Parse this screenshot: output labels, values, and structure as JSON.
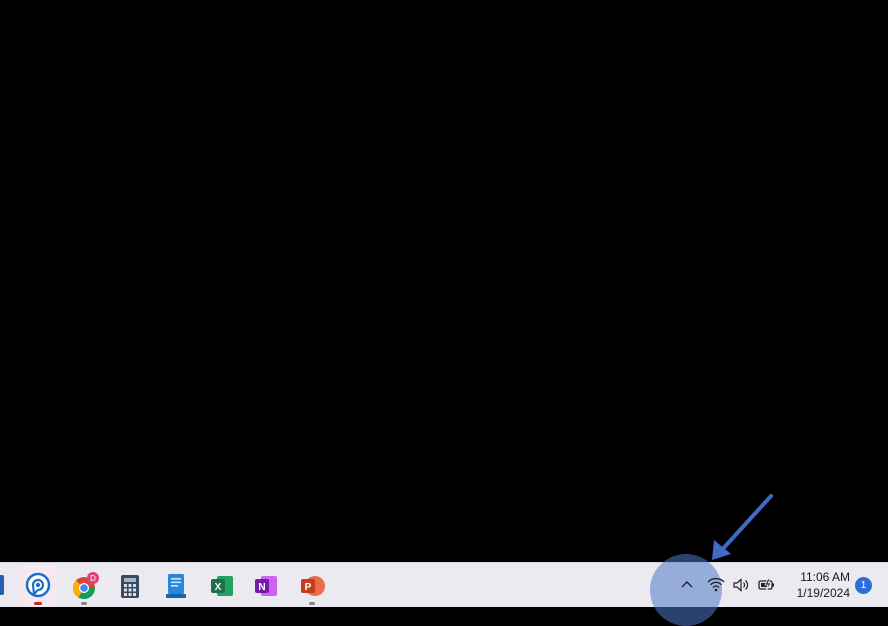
{
  "taskbar": {
    "apps": [
      {
        "name": "Personal assistant",
        "icon": "chat-bubble-icon",
        "active": true
      },
      {
        "name": "Google Chrome",
        "icon": "chrome-icon",
        "badge": "D"
      },
      {
        "name": "Calculator",
        "icon": "calculator-icon"
      },
      {
        "name": "Document app",
        "icon": "document-icon"
      },
      {
        "name": "Excel",
        "icon": "excel-icon",
        "letter": "X"
      },
      {
        "name": "OneNote",
        "icon": "onenote-icon",
        "letter": "N"
      },
      {
        "name": "PowerPoint",
        "icon": "powerpoint-icon",
        "letter": "P"
      }
    ],
    "tray": {
      "time": "11:06 AM",
      "date": "1/19/2024",
      "notification_count": "1"
    }
  },
  "colors": {
    "taskbar": "#eaeaf0",
    "highlight": "#5078c8",
    "arrow": "#3f6bc4",
    "excel": "#1e7145",
    "onenote": "#7719aa",
    "powerpoint": "#c43e1c"
  }
}
